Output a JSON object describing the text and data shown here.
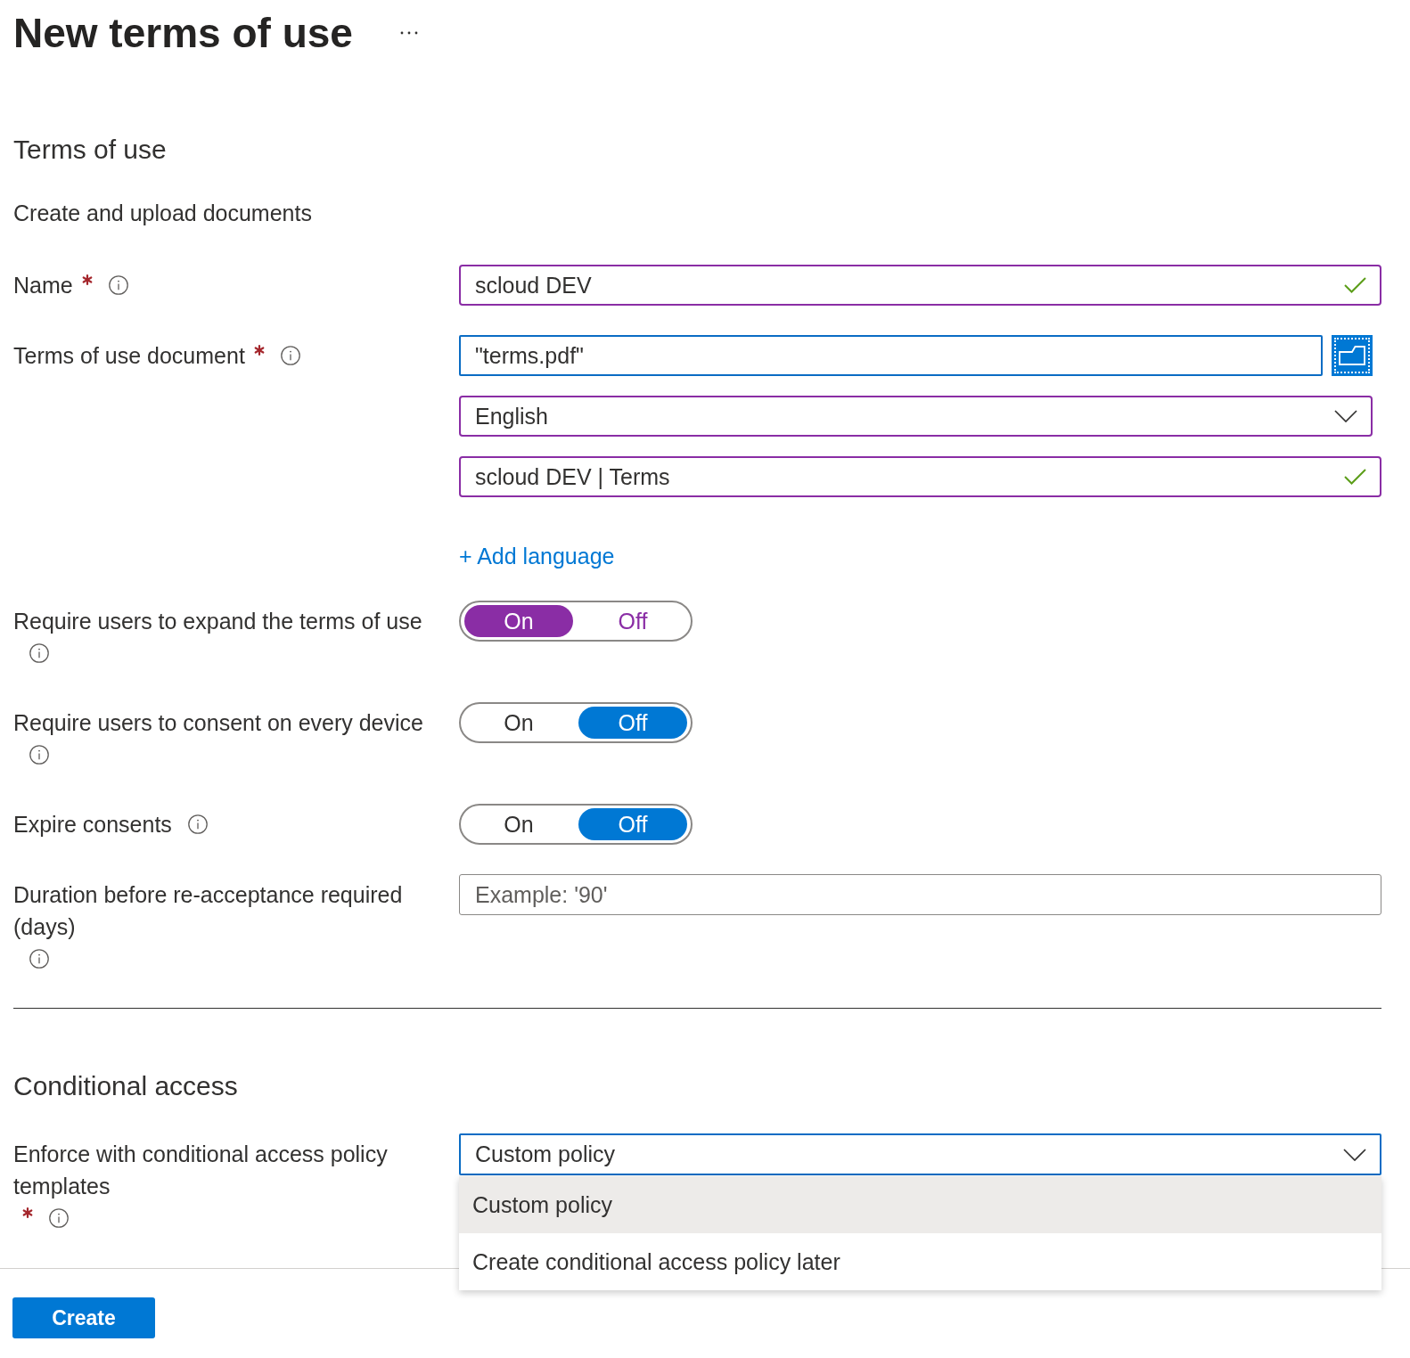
{
  "header": {
    "title": "New terms of use"
  },
  "terms_section": {
    "heading": "Terms of use",
    "subheading": "Create and upload documents",
    "rows": [
      {
        "kind": "text",
        "label": "Name",
        "required": true,
        "info": true,
        "value": "scloud DEV",
        "dirty": true,
        "valid": true
      },
      {
        "kind": "document",
        "label": "Terms of use document",
        "required": true,
        "info": true,
        "file": {
          "value": "\"terms.pdf\"",
          "focused": true
        },
        "browse": {
          "focused": true
        },
        "language": {
          "value": "English",
          "dirty": true
        },
        "display_name": {
          "value": "scloud DEV | Terms",
          "dirty": true,
          "valid": true
        },
        "add_language": "+ Add language"
      },
      {
        "kind": "toggle",
        "label": "Require users to expand the terms of use",
        "required": false,
        "info": true,
        "dirty": true,
        "options": [
          {
            "label": "On",
            "selected": true
          },
          {
            "label": "Off",
            "selected": false
          }
        ]
      },
      {
        "kind": "toggle",
        "label": "Require users to consent on every device",
        "required": false,
        "info": true,
        "dirty": false,
        "options": [
          {
            "label": "On",
            "selected": false
          },
          {
            "label": "Off",
            "selected": true
          }
        ]
      },
      {
        "kind": "toggle",
        "label": "Expire consents",
        "required": false,
        "info": true,
        "dirty": false,
        "options": [
          {
            "label": "On",
            "selected": false
          },
          {
            "label": "Off",
            "selected": true
          }
        ]
      },
      {
        "kind": "number",
        "label": "Duration before re-acceptance required (days)",
        "required": false,
        "info": true,
        "placeholder": "Example: '90'",
        "dirty": false
      }
    ]
  },
  "conditional_access": {
    "heading": "Conditional access",
    "rows": [
      {
        "kind": "dropdown",
        "label": "Enforce with conditional access policy templates",
        "required": true,
        "info": true,
        "value": "Custom policy",
        "focused": true,
        "expanded": true,
        "options": [
          {
            "label": "Custom policy",
            "selected": true
          },
          {
            "label": "Create conditional access policy later",
            "selected": false
          }
        ]
      }
    ]
  },
  "footer": {
    "buttons": [
      {
        "label": "Create",
        "kind": "primary"
      }
    ]
  }
}
